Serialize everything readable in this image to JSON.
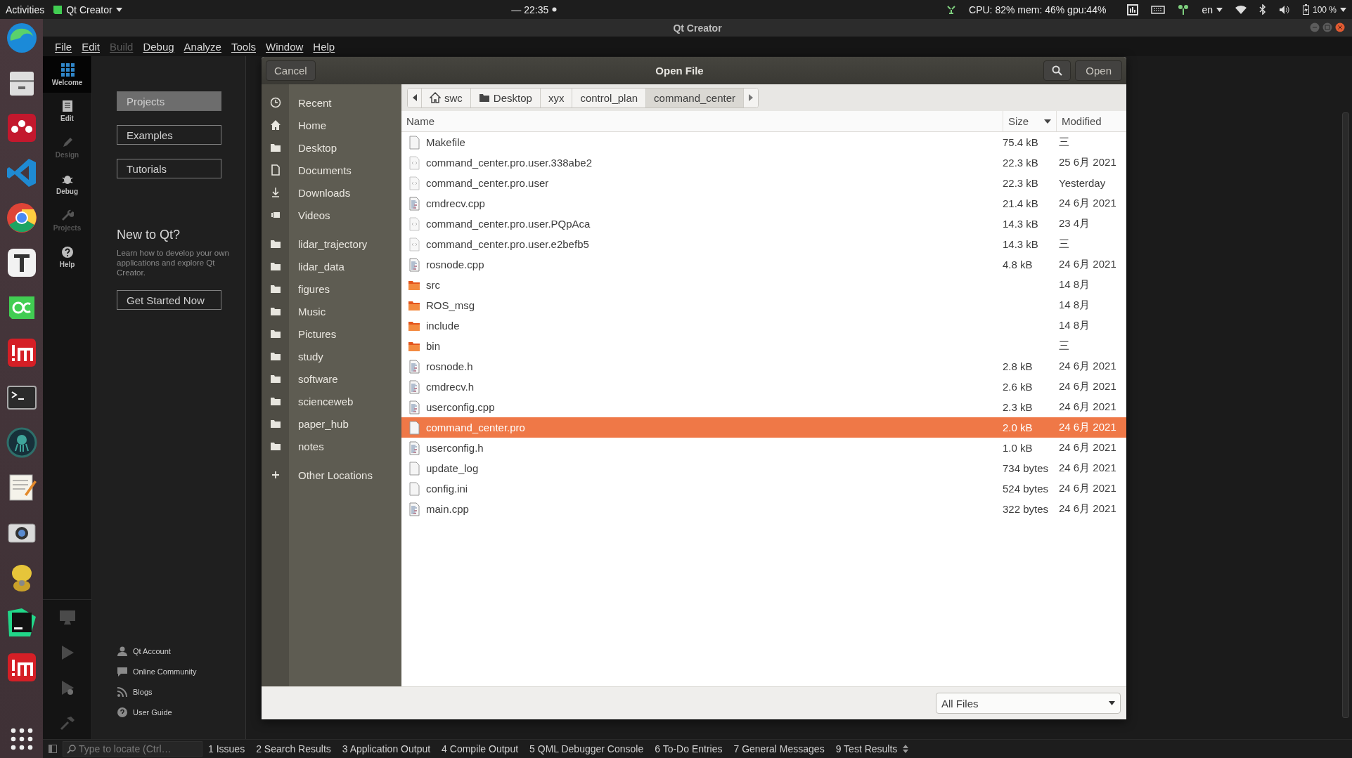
{
  "top_bar": {
    "activities": "Activities",
    "app_menu": "Qt Creator",
    "clock": "— 22:35",
    "cpu_stats": "CPU: 82% mem: 46% gpu:44%",
    "language": "en",
    "battery": "100 %"
  },
  "window": {
    "title": "Qt Creator"
  },
  "menu": [
    {
      "label": "File",
      "disabled": false
    },
    {
      "label": "Edit",
      "disabled": false
    },
    {
      "label": "Build",
      "disabled": true
    },
    {
      "label": "Debug",
      "disabled": false
    },
    {
      "label": "Analyze",
      "disabled": false
    },
    {
      "label": "Tools",
      "disabled": false
    },
    {
      "label": "Window",
      "disabled": false
    },
    {
      "label": "Help",
      "disabled": false
    }
  ],
  "modes": [
    {
      "label": "Welcome",
      "kind": "welcome",
      "selected": true,
      "disabled": false
    },
    {
      "label": "Edit",
      "kind": "edit",
      "selected": false,
      "disabled": false
    },
    {
      "label": "Design",
      "kind": "design",
      "selected": false,
      "disabled": true
    },
    {
      "label": "Debug",
      "kind": "debug",
      "selected": false,
      "disabled": false
    },
    {
      "label": "Projects",
      "kind": "projects",
      "selected": false,
      "disabled": true
    },
    {
      "label": "Help",
      "kind": "help",
      "selected": false,
      "disabled": false
    }
  ],
  "welcome": {
    "tabs": [
      {
        "label": "Projects",
        "selected": true
      },
      {
        "label": "Examples",
        "selected": false
      },
      {
        "label": "Tutorials",
        "selected": false
      }
    ],
    "heading": "New to Qt?",
    "intro": "Learn how to develop your own applications and explore Qt Creator.",
    "cta": "Get Started Now",
    "links": [
      {
        "label": "Qt Account",
        "kind": "account"
      },
      {
        "label": "Online Community",
        "kind": "community"
      },
      {
        "label": "Blogs",
        "kind": "blogs"
      },
      {
        "label": "User Guide",
        "kind": "guide"
      }
    ]
  },
  "dialog": {
    "cancel": "Cancel",
    "title": "Open File",
    "open": "Open",
    "places": [
      {
        "items": [
          {
            "label": "Recent",
            "kind": "recent"
          },
          {
            "label": "Home",
            "kind": "home"
          },
          {
            "label": "Desktop",
            "kind": "folder"
          },
          {
            "label": "Documents",
            "kind": "document"
          },
          {
            "label": "Downloads",
            "kind": "download"
          },
          {
            "label": "Videos",
            "kind": "video"
          }
        ]
      },
      {
        "items": [
          {
            "label": "lidar_trajectory",
            "kind": "folder"
          },
          {
            "label": "lidar_data",
            "kind": "folder"
          },
          {
            "label": "figures",
            "kind": "folder"
          },
          {
            "label": "Music",
            "kind": "folder"
          },
          {
            "label": "Pictures",
            "kind": "folder"
          },
          {
            "label": "study",
            "kind": "folder"
          },
          {
            "label": "software",
            "kind": "folder"
          },
          {
            "label": "scienceweb",
            "kind": "folder"
          },
          {
            "label": "paper_hub",
            "kind": "folder"
          },
          {
            "label": "notes",
            "kind": "folder"
          }
        ]
      },
      {
        "items": [
          {
            "label": "Other Locations",
            "kind": "other"
          }
        ]
      }
    ],
    "path": [
      {
        "label": "swc",
        "kind": "home",
        "selected": false
      },
      {
        "label": "Desktop",
        "kind": "folder",
        "selected": false
      },
      {
        "label": "xyx",
        "kind": "plain",
        "selected": false
      },
      {
        "label": "control_plan",
        "kind": "plain",
        "selected": false
      },
      {
        "label": "command_center",
        "kind": "plain",
        "selected": true
      }
    ],
    "columns": [
      {
        "label": "Name",
        "sorted": false
      },
      {
        "label": "Size",
        "sorted": true
      },
      {
        "label": "Modified",
        "sorted": false
      }
    ],
    "files": [
      {
        "name": "Makefile",
        "size": "75.4 kB",
        "modified": "三",
        "kind": "blank",
        "selected": false
      },
      {
        "name": "command_center.pro.user.338abe2",
        "size": "22.3 kB",
        "modified": "25 6月 2021",
        "kind": "xml",
        "selected": false
      },
      {
        "name": "command_center.pro.user",
        "size": "22.3 kB",
        "modified": "Yesterday",
        "kind": "xml",
        "selected": false
      },
      {
        "name": "cmdrecv.cpp",
        "size": "21.4 kB",
        "modified": "24 6月 2021",
        "kind": "source",
        "selected": false
      },
      {
        "name": "command_center.pro.user.PQpAca",
        "size": "14.3 kB",
        "modified": "23 4月",
        "kind": "xml",
        "selected": false
      },
      {
        "name": "command_center.pro.user.e2befb5",
        "size": "14.3 kB",
        "modified": "三",
        "kind": "xml",
        "selected": false
      },
      {
        "name": "rosnode.cpp",
        "size": "4.8 kB",
        "modified": "24 6月 2021",
        "kind": "source",
        "selected": false
      },
      {
        "name": "src",
        "modified": "14 8月",
        "kind": "folder",
        "selected": false
      },
      {
        "name": "ROS_msg",
        "modified": "14 8月",
        "kind": "folder",
        "selected": false
      },
      {
        "name": "include",
        "modified": "14 8月",
        "kind": "folder",
        "selected": false
      },
      {
        "name": "bin",
        "modified": "三",
        "kind": "folder",
        "selected": false
      },
      {
        "name": "rosnode.h",
        "size": "2.8 kB",
        "modified": "24 6月 2021",
        "kind": "source",
        "selected": false
      },
      {
        "name": "cmdrecv.h",
        "size": "2.6 kB",
        "modified": "24 6月 2021",
        "kind": "source",
        "selected": false
      },
      {
        "name": "userconfig.cpp",
        "size": "2.3 kB",
        "modified": "24 6月 2021",
        "kind": "source",
        "selected": false
      },
      {
        "name": "command_center.pro",
        "size": "2.0 kB",
        "modified": "24 6月 2021",
        "kind": "blank",
        "selected": true
      },
      {
        "name": "userconfig.h",
        "size": "1.0 kB",
        "modified": "24 6月 2021",
        "kind": "source",
        "selected": false
      },
      {
        "name": "update_log",
        "size": "734 bytes",
        "modified": "24 6月 2021",
        "kind": "blank",
        "selected": false
      },
      {
        "name": "config.ini",
        "size": "524 bytes",
        "modified": "24 6月 2021",
        "kind": "blank",
        "selected": false
      },
      {
        "name": "main.cpp",
        "size": "322 bytes",
        "modified": "24 6月 2021",
        "kind": "source",
        "selected": false
      }
    ],
    "filter": "All Files"
  },
  "locator": {
    "placeholder": "Type to locate (Ctrl…"
  },
  "output_tabs": [
    {
      "number": "1",
      "label": "Issues"
    },
    {
      "number": "2",
      "label": "Search Results"
    },
    {
      "number": "3",
      "label": "Application Output"
    },
    {
      "number": "4",
      "label": "Compile Output"
    },
    {
      "number": "5",
      "label": "QML Debugger Console"
    },
    {
      "number": "6",
      "label": "To-Do Entries"
    },
    {
      "number": "7",
      "label": "General Messages"
    },
    {
      "number": "9",
      "label": "Test Results"
    }
  ]
}
